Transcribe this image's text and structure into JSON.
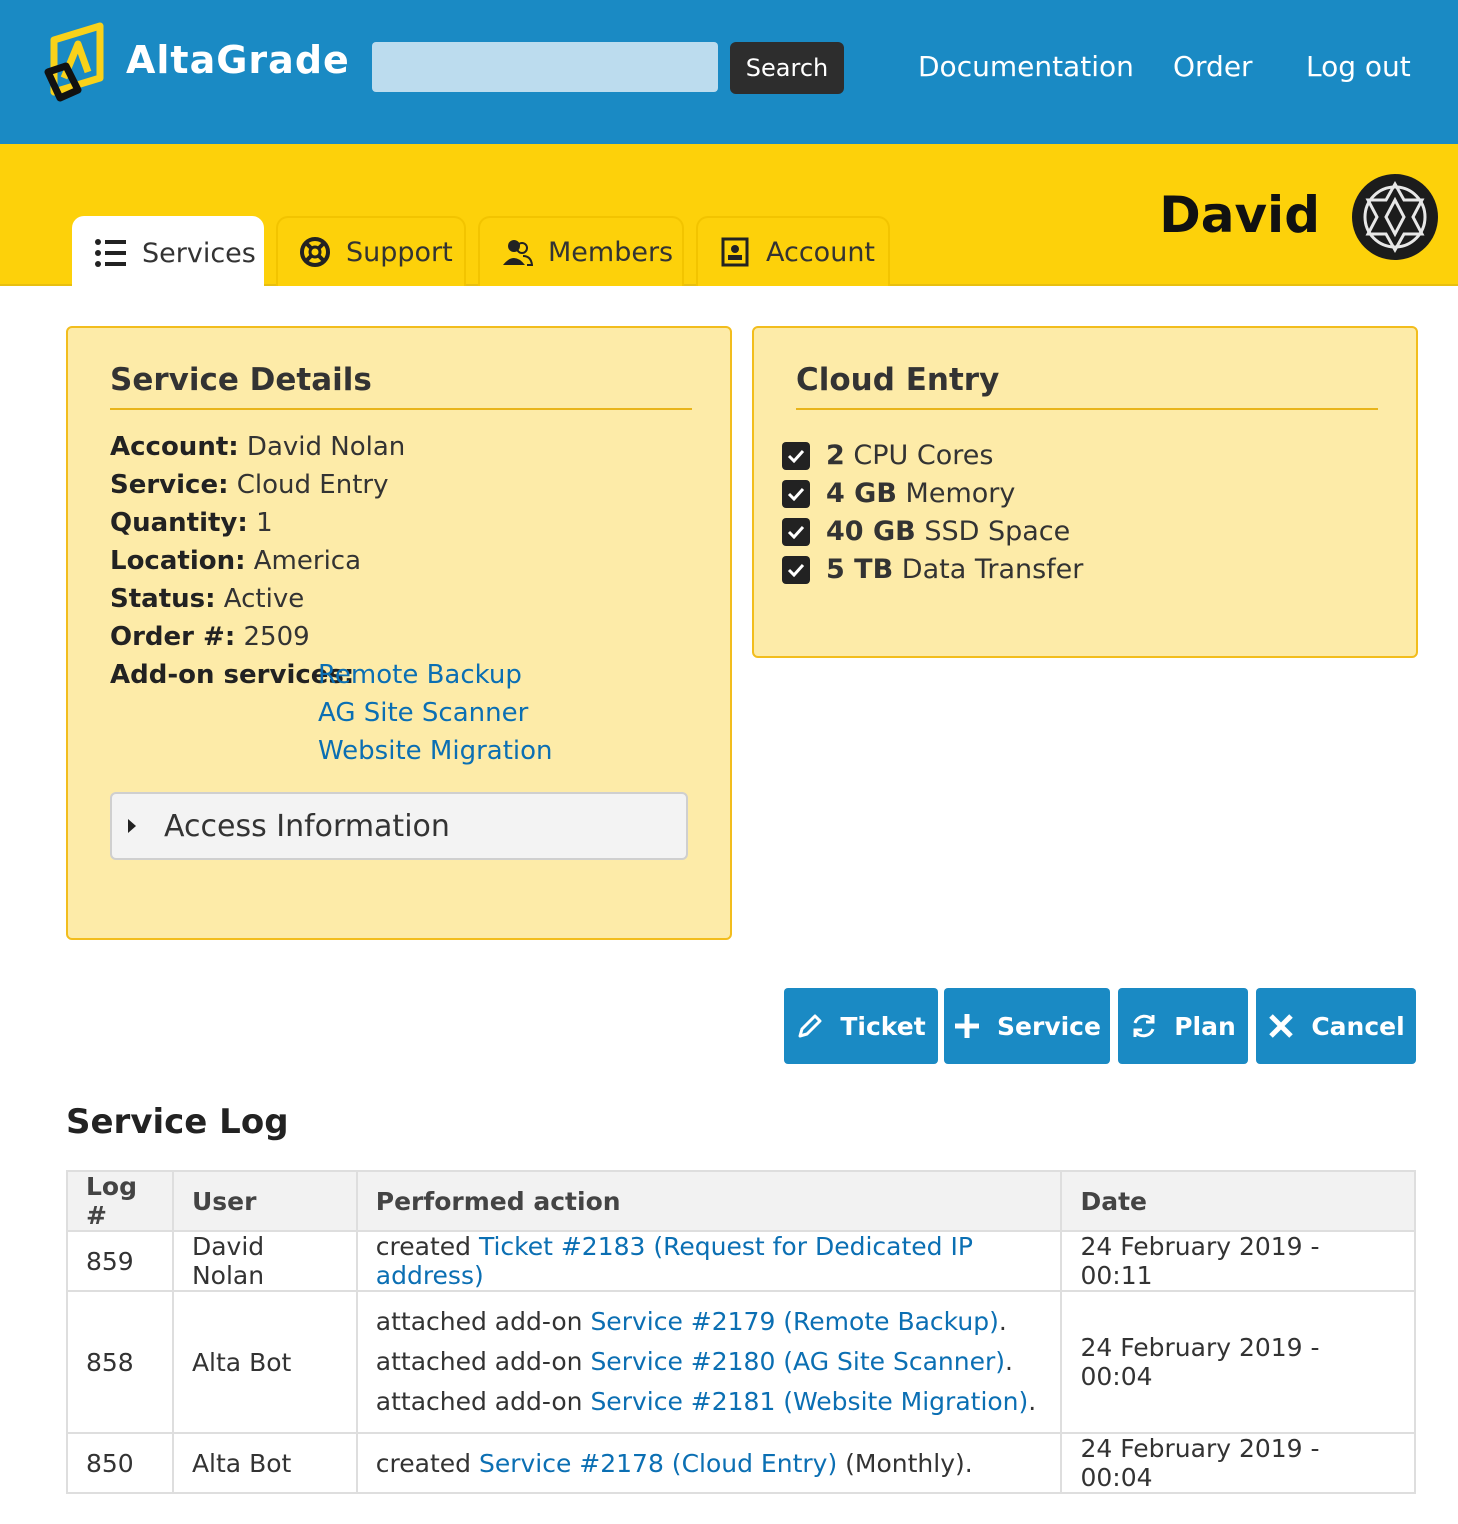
{
  "header": {
    "brand": "AltaGrade",
    "search_placeholder": "",
    "search_button": "Search",
    "nav": [
      "Documentation",
      "Order",
      "Log out"
    ]
  },
  "colors": {
    "primary_blue": "#1a8ac4",
    "brand_yellow": "#fdd10a",
    "panel_fill": "#fdeba8",
    "link": "#0b6fb3"
  },
  "tabs": [
    {
      "label": "Services",
      "icon": "list-icon",
      "active": true
    },
    {
      "label": "Support",
      "icon": "life-ring-icon",
      "active": false
    },
    {
      "label": "Members",
      "icon": "users-icon",
      "active": false
    },
    {
      "label": "Account",
      "icon": "contact-card-icon",
      "active": false
    }
  ],
  "user": {
    "name": "David"
  },
  "service_details": {
    "title": "Service Details",
    "fields": [
      {
        "label": "Account:",
        "value": "David Nolan"
      },
      {
        "label": "Service:",
        "value": "Cloud Entry"
      },
      {
        "label": "Quantity:",
        "value": "1"
      },
      {
        "label": "Location:",
        "value": "America"
      },
      {
        "label": "Status:",
        "value": "Active"
      },
      {
        "label": "Order #:",
        "value": "2509"
      }
    ],
    "addons_label": "Add-on services:",
    "addons": [
      "Remote Backup",
      "AG Site Scanner",
      "Website Migration"
    ],
    "access_label": "Access Information"
  },
  "plan": {
    "title": "Cloud Entry",
    "features": [
      {
        "amount": "2",
        "text": "CPU Cores"
      },
      {
        "amount": "4 GB",
        "text": "Memory"
      },
      {
        "amount": "40 GB",
        "text": "SSD Space"
      },
      {
        "amount": "5 TB",
        "text": "Data Transfer"
      }
    ]
  },
  "actions": [
    {
      "label": "Ticket",
      "icon": "pencil-icon"
    },
    {
      "label": "Service",
      "icon": "plus-icon"
    },
    {
      "label": "Plan",
      "icon": "refresh-icon"
    },
    {
      "label": "Cancel",
      "icon": "close-icon"
    }
  ],
  "log": {
    "title": "Service Log",
    "columns": [
      "Log #",
      "User",
      "Performed action",
      "Date"
    ],
    "rows": [
      {
        "id": "859",
        "user": "David Nolan",
        "actions": [
          {
            "prefix": "created ",
            "link": "Ticket #2183 (Request for Dedicated IP address)",
            "suffix": ""
          }
        ],
        "date": "24 February 2019 - 00:11"
      },
      {
        "id": "858",
        "user": "Alta Bot",
        "actions": [
          {
            "prefix": "attached add-on ",
            "link": "Service #2179 (Remote Backup)",
            "suffix": "."
          },
          {
            "prefix": "attached add-on ",
            "link": "Service #2180 (AG Site Scanner)",
            "suffix": "."
          },
          {
            "prefix": "attached add-on ",
            "link": "Service #2181 (Website Migration)",
            "suffix": "."
          }
        ],
        "date": "24 February 2019 - 00:04"
      },
      {
        "id": "850",
        "user": "Alta Bot",
        "actions": [
          {
            "prefix": "created ",
            "link": "Service #2178 (Cloud Entry)",
            "suffix": " (Monthly)."
          }
        ],
        "date": "24 February 2019 - 00:04"
      }
    ]
  }
}
